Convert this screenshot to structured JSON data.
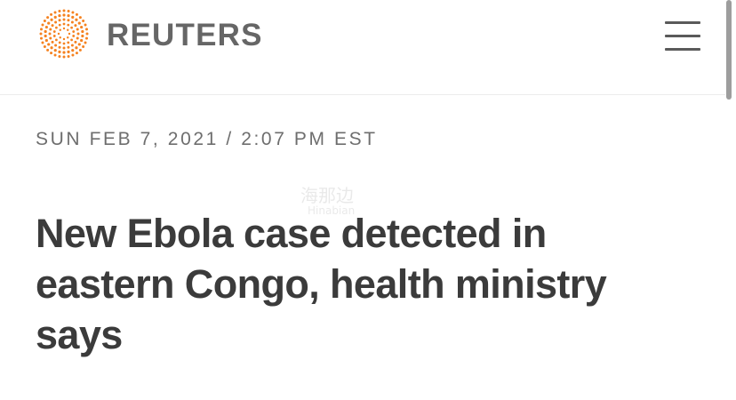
{
  "header": {
    "brand": "REUTERS",
    "logo_icon": "reuters-dot-logo-icon",
    "menu_icon": "hamburger-menu-icon",
    "brand_color": "#f58220"
  },
  "article": {
    "dateline": "SUN FEB 7, 2021 / 2:07 PM EST",
    "headline": "New Ebola case detected in eastern Congo, health ministry says"
  },
  "watermark": {
    "text": "海那边",
    "subtext": "Hinabian"
  }
}
